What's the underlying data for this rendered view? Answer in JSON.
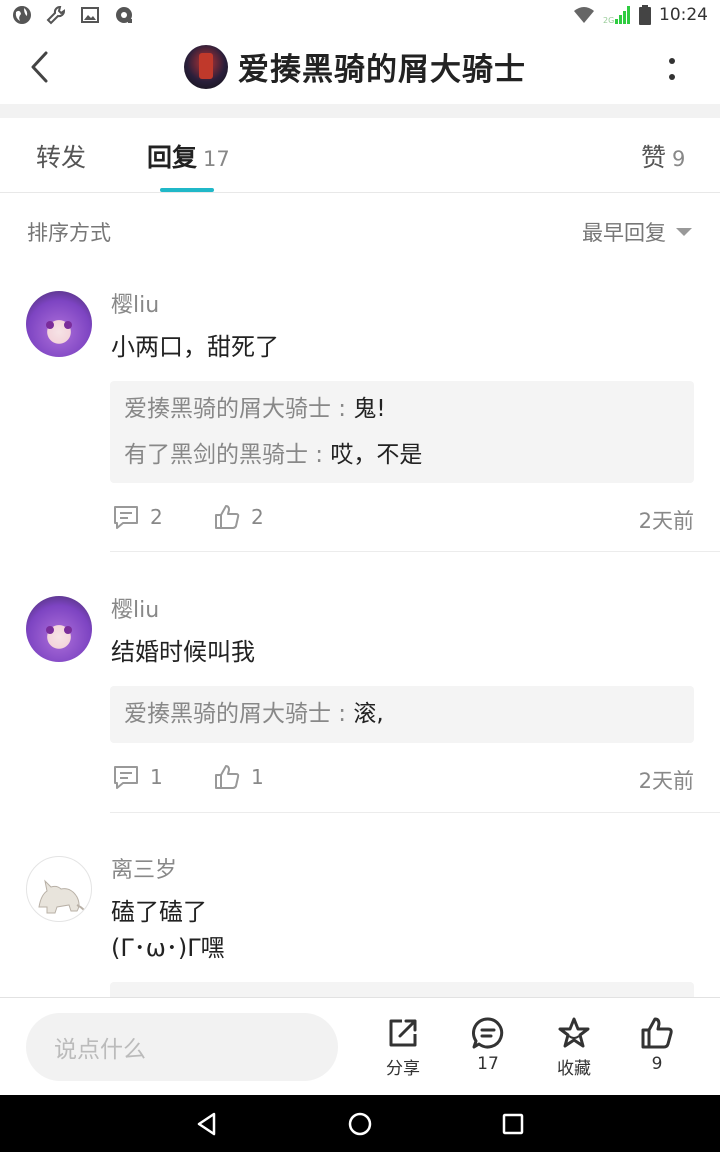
{
  "status_bar": {
    "time": "10:24",
    "network_label": "2G"
  },
  "header": {
    "title": "爱揍黑骑的屑大骑士"
  },
  "tabs": [
    {
      "label": "转发",
      "count": ""
    },
    {
      "label": "回复",
      "count": "17"
    },
    {
      "label": "赞",
      "count": "9"
    }
  ],
  "sort": {
    "label": "排序方式",
    "selected": "最早回复"
  },
  "comments": [
    {
      "username": "樱liu",
      "text": "小两口，甜死了",
      "replies": [
        {
          "author": "爱揍黑骑的屑大骑士",
          "sep": " : ",
          "text": "鬼!"
        },
        {
          "author": "有了黑剑的黑骑士",
          "sep": " : ",
          "text": "哎，不是"
        }
      ],
      "reply_count": "2",
      "like_count": "2",
      "time": "2天前"
    },
    {
      "username": "樱liu",
      "text": "结婚时候叫我",
      "replies": [
        {
          "author": "爱揍黑骑的屑大骑士",
          "sep": " : ",
          "text": "滚,"
        }
      ],
      "reply_count": "1",
      "like_count": "1",
      "time": "2天前"
    },
    {
      "username": "离三岁",
      "text_line1": "磕了磕了",
      "text_line2": "(Γ･ω･)Γ嘿"
    }
  ],
  "bottom_bar": {
    "input_placeholder": "说点什么",
    "share_label": "分享",
    "comment_count": "17",
    "favorite_label": "收藏",
    "like_count": "9"
  },
  "colors": {
    "accent": "#20b8c8",
    "text": "#222222",
    "muted": "#888888",
    "quote_bg": "#f4f4f4"
  }
}
